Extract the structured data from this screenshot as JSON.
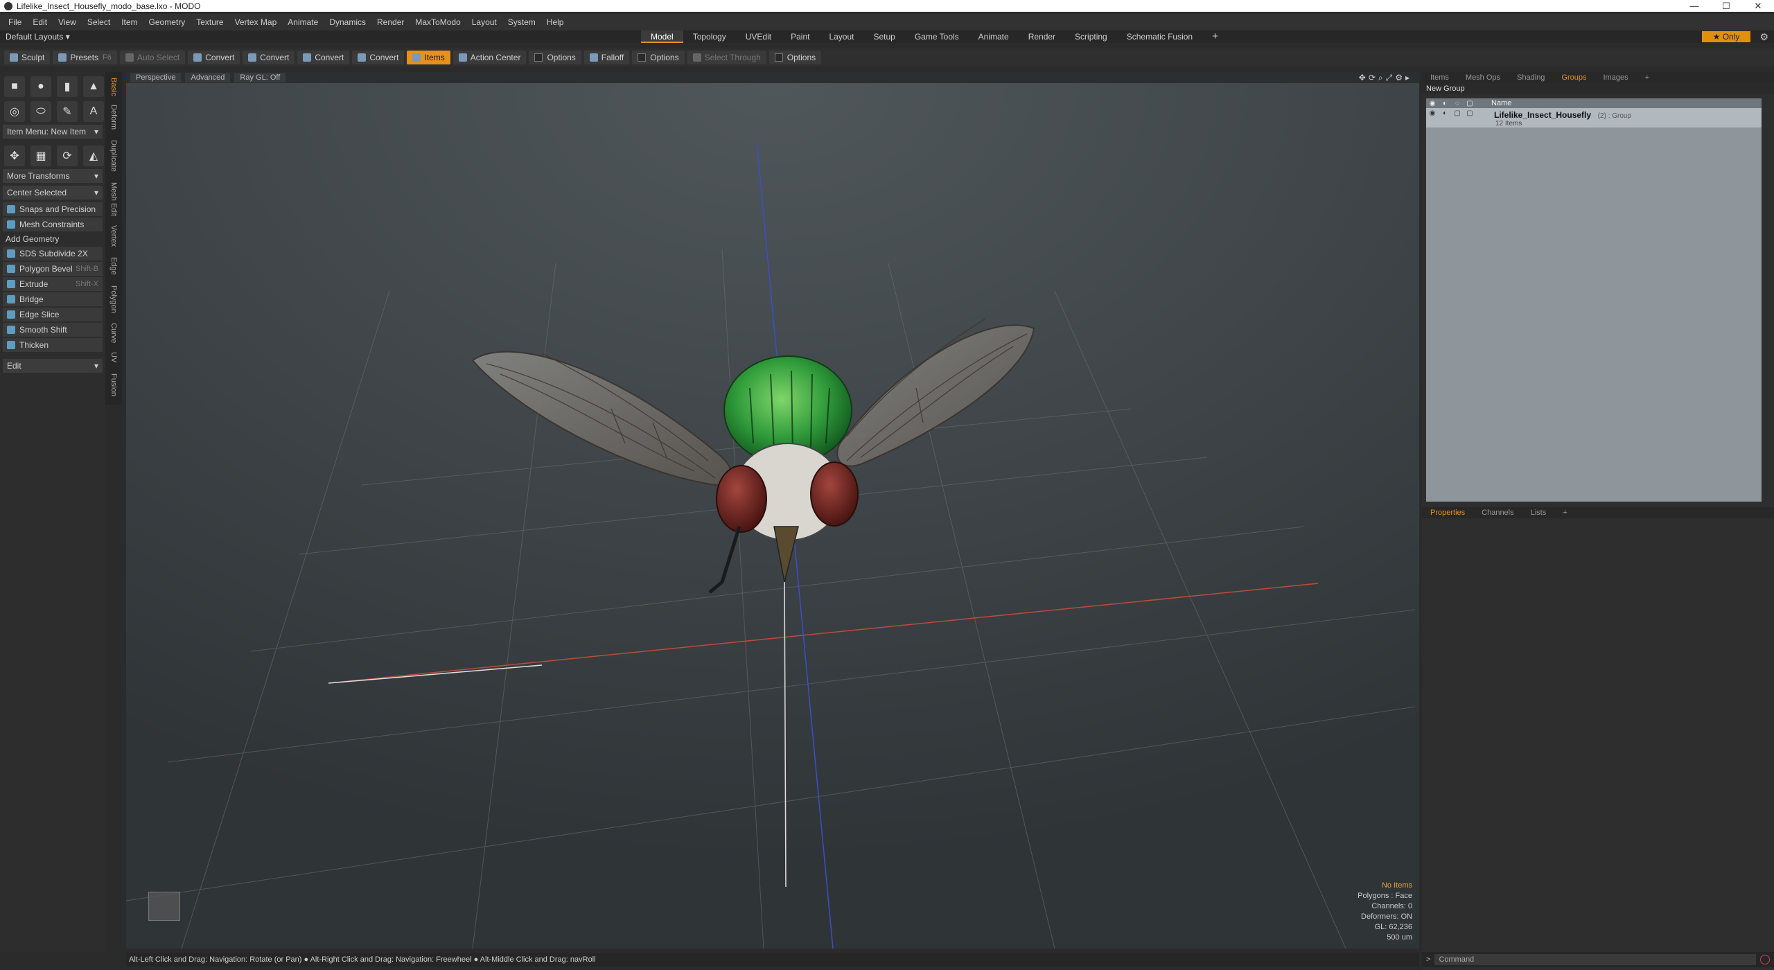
{
  "window": {
    "title": "Lifelike_Insect_Housefly_modo_base.lxo - MODO",
    "controls": [
      "—",
      "☐",
      "✕"
    ]
  },
  "menu": [
    "File",
    "Edit",
    "View",
    "Select",
    "Item",
    "Geometry",
    "Texture",
    "Vertex Map",
    "Animate",
    "Dynamics",
    "Render",
    "MaxToModo",
    "Layout",
    "System",
    "Help"
  ],
  "layouts": {
    "selector": "Default Layouts ▾",
    "tabs": [
      "Model",
      "Topology",
      "UVEdit",
      "Paint",
      "Layout",
      "Setup",
      "Game Tools",
      "Animate",
      "Render",
      "Scripting",
      "Schematic Fusion",
      "+"
    ],
    "active": "Model",
    "only": "★ Only"
  },
  "toolbar": {
    "sculpt": "Sculpt",
    "presets": "Presets",
    "presets_key": "F6",
    "auto_select": "Auto Select",
    "convert": "Convert",
    "items": "Items",
    "action_center": "Action Center",
    "options": "Options",
    "falloff": "Falloff",
    "select_through": "Select Through"
  },
  "left_panel": {
    "item_menu": "Item Menu: New Item",
    "more_transforms": "More Transforms",
    "center_selected": "Center Selected",
    "snaps": "Snaps and Precision",
    "mesh_constraints": "Mesh Constraints",
    "add_geometry": "Add Geometry",
    "tools": [
      {
        "label": "SDS Subdivide 2X",
        "key": ""
      },
      {
        "label": "Polygon Bevel",
        "key": "Shift-B"
      },
      {
        "label": "Extrude",
        "key": "Shift-X"
      },
      {
        "label": "Bridge",
        "key": ""
      },
      {
        "label": "Edge Slice",
        "key": ""
      },
      {
        "label": "Smooth Shift",
        "key": ""
      },
      {
        "label": "Thicken",
        "key": ""
      }
    ],
    "edit": "Edit",
    "side_tabs": [
      "Basic",
      "Deform",
      "Duplicate",
      "Mesh Edit",
      "Vertex",
      "Edge",
      "Polygon",
      "Curve",
      "UV",
      "Fusion"
    ]
  },
  "viewport": {
    "view": "Perspective",
    "mode": "Advanced",
    "raygl": "Ray GL: Off",
    "stats": {
      "no_items": "No Items",
      "polygons": "Polygons : Face",
      "channels": "Channels: 0",
      "deformers": "Deformers: ON",
      "gl": "GL: 62,236",
      "scale": "500 um"
    }
  },
  "status": "Alt-Left Click and Drag: Navigation: Rotate (or Pan) ● Alt-Right Click and Drag: Navigation: Freewheel ● Alt-Middle Click and Drag: navRoll",
  "right_panel": {
    "tabs": [
      "Items",
      "Mesh Ops",
      "Shading",
      "Groups",
      "Images",
      "+"
    ],
    "active_tab": "Groups",
    "new_group": "New Group",
    "col_name": "Name",
    "group": {
      "name": "Lifelike_Insect_Housefly",
      "tag": "(2) : Group",
      "count": "12 Items"
    },
    "prop_tabs": [
      "Properties",
      "Channels",
      "Lists",
      "+"
    ],
    "active_prop_tab": "Properties",
    "command_placeholder": "Command"
  }
}
